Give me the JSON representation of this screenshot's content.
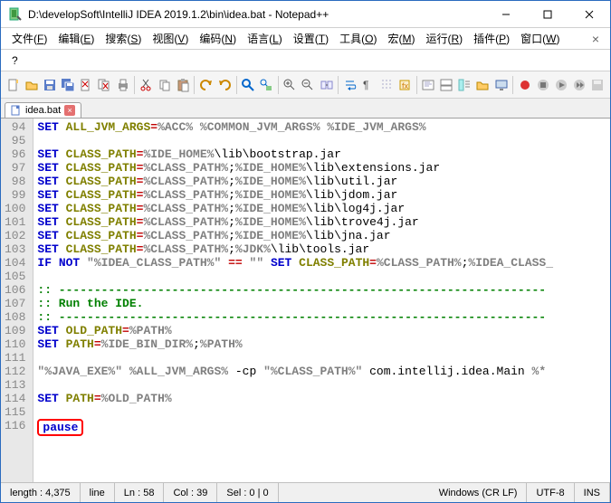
{
  "window": {
    "title": "D:\\developSoft\\IntelliJ IDEA 2019.1.2\\bin\\idea.bat - Notepad++"
  },
  "menu": [
    {
      "label": "文件",
      "u": "F"
    },
    {
      "label": "编辑",
      "u": "E"
    },
    {
      "label": "搜索",
      "u": "S"
    },
    {
      "label": "视图",
      "u": "V"
    },
    {
      "label": "编码",
      "u": "N"
    },
    {
      "label": "语言",
      "u": "L"
    },
    {
      "label": "设置",
      "u": "T"
    },
    {
      "label": "工具",
      "u": "O"
    },
    {
      "label": "宏",
      "u": "M"
    },
    {
      "label": "运行",
      "u": "R"
    },
    {
      "label": "插件",
      "u": "P"
    },
    {
      "label": "窗口",
      "u": "W"
    }
  ],
  "menu_help": "?",
  "tab": {
    "name": "idea.bat"
  },
  "code": {
    "start": 94,
    "lines": [
      {
        "n": 94,
        "html": "<span class='kw'>SET</span> <span class='id'>ALL_JVM_ARGS</span><span class='op'>=</span><span class='str'>%ACC%</span> <span class='str'>%COMMON_JVM_ARGS%</span> <span class='str'>%IDE_JVM_ARGS%</span>"
      },
      {
        "n": 95,
        "html": ""
      },
      {
        "n": 96,
        "html": "<span class='kw'>SET</span> <span class='id'>CLASS_PATH</span><span class='op'>=</span><span class='str'>%IDE_HOME%</span>\\lib\\bootstrap.jar"
      },
      {
        "n": 97,
        "html": "<span class='kw'>SET</span> <span class='id'>CLASS_PATH</span><span class='op'>=</span><span class='str'>%CLASS_PATH%</span>;<span class='str'>%IDE_HOME%</span>\\lib\\extensions.jar"
      },
      {
        "n": 98,
        "html": "<span class='kw'>SET</span> <span class='id'>CLASS_PATH</span><span class='op'>=</span><span class='str'>%CLASS_PATH%</span>;<span class='str'>%IDE_HOME%</span>\\lib\\util.jar"
      },
      {
        "n": 99,
        "html": "<span class='kw'>SET</span> <span class='id'>CLASS_PATH</span><span class='op'>=</span><span class='str'>%CLASS_PATH%</span>;<span class='str'>%IDE_HOME%</span>\\lib\\jdom.jar"
      },
      {
        "n": 100,
        "html": "<span class='kw'>SET</span> <span class='id'>CLASS_PATH</span><span class='op'>=</span><span class='str'>%CLASS_PATH%</span>;<span class='str'>%IDE_HOME%</span>\\lib\\log4j.jar"
      },
      {
        "n": 101,
        "html": "<span class='kw'>SET</span> <span class='id'>CLASS_PATH</span><span class='op'>=</span><span class='str'>%CLASS_PATH%</span>;<span class='str'>%IDE_HOME%</span>\\lib\\trove4j.jar"
      },
      {
        "n": 102,
        "html": "<span class='kw'>SET</span> <span class='id'>CLASS_PATH</span><span class='op'>=</span><span class='str'>%CLASS_PATH%</span>;<span class='str'>%IDE_HOME%</span>\\lib\\jna.jar"
      },
      {
        "n": 103,
        "html": "<span class='kw'>SET</span> <span class='id'>CLASS_PATH</span><span class='op'>=</span><span class='str'>%CLASS_PATH%</span>;<span class='str'>%JDK%</span>\\lib\\tools.jar"
      },
      {
        "n": 104,
        "html": "<span class='kw'>IF</span> <span class='kw'>NOT</span> <span class='str'>\"%IDEA_CLASS_PATH%\"</span> <span class='op'>==</span> <span class='str'>\"\"</span> <span class='kw'>SET</span> <span class='id'>CLASS_PATH</span><span class='op'>=</span><span class='str'>%CLASS_PATH%</span>;<span class='str'>%IDEA_CLASS_</span>"
      },
      {
        "n": 105,
        "html": ""
      },
      {
        "n": 106,
        "html": "<span class='cm'>:: ---------------------------------------------------------------------</span>"
      },
      {
        "n": 107,
        "html": "<span class='cm'>:: Run the IDE.</span>"
      },
      {
        "n": 108,
        "html": "<span class='cm'>:: ---------------------------------------------------------------------</span>"
      },
      {
        "n": 109,
        "html": "<span class='kw'>SET</span> <span class='id'>OLD_PATH</span><span class='op'>=</span><span class='str'>%PATH%</span>"
      },
      {
        "n": 110,
        "html": "<span class='kw'>SET</span> <span class='id'>PATH</span><span class='op'>=</span><span class='str'>%IDE_BIN_DIR%</span>;<span class='str'>%PATH%</span>"
      },
      {
        "n": 111,
        "html": ""
      },
      {
        "n": 112,
        "html": "<span class='str'>\"%JAVA_EXE%\"</span> <span class='str'>%ALL_JVM_ARGS%</span> -cp <span class='str'>\"%CLASS_PATH%\"</span> com.intellij.idea.Main <span class='str'>%*</span>"
      },
      {
        "n": 113,
        "html": ""
      },
      {
        "n": 114,
        "html": "<span class='kw'>SET</span> <span class='id'>PATH</span><span class='op'>=</span><span class='str'>%OLD_PATH%</span>"
      },
      {
        "n": 115,
        "html": ""
      },
      {
        "n": 116,
        "html": "<span class='redbox'><span class='kw'>pause</span></span>"
      }
    ]
  },
  "status": {
    "length": "length : 4,375",
    "lines": "line",
    "ln": "Ln : 58",
    "col": "Col : 39",
    "sel": "Sel : 0 | 0",
    "eol": "Windows (CR LF)",
    "enc": "UTF-8",
    "ins": "INS"
  },
  "icons": {
    "new": "new-icon",
    "open": "open-icon",
    "save": "save-icon",
    "saveall": "saveall-icon",
    "close": "close-icon",
    "closeall": "closeall-icon",
    "print": "print-icon",
    "cut": "cut-icon",
    "copy": "copy-icon",
    "paste": "paste-icon",
    "undo": "undo-icon",
    "redo": "redo-icon",
    "find": "find-icon",
    "replace": "replace-icon",
    "zoomin": "zoomin-icon",
    "zoomout": "zoomout-icon",
    "sync": "sync-icon",
    "wrap": "wrap-icon",
    "showall": "showall-icon",
    "indent": "indent-icon",
    "folder": "folder-icon",
    "doclist": "doclist-icon",
    "monitor": "monitor-icon",
    "record": "record-icon",
    "stop": "stop-icon",
    "play": "play-icon"
  }
}
